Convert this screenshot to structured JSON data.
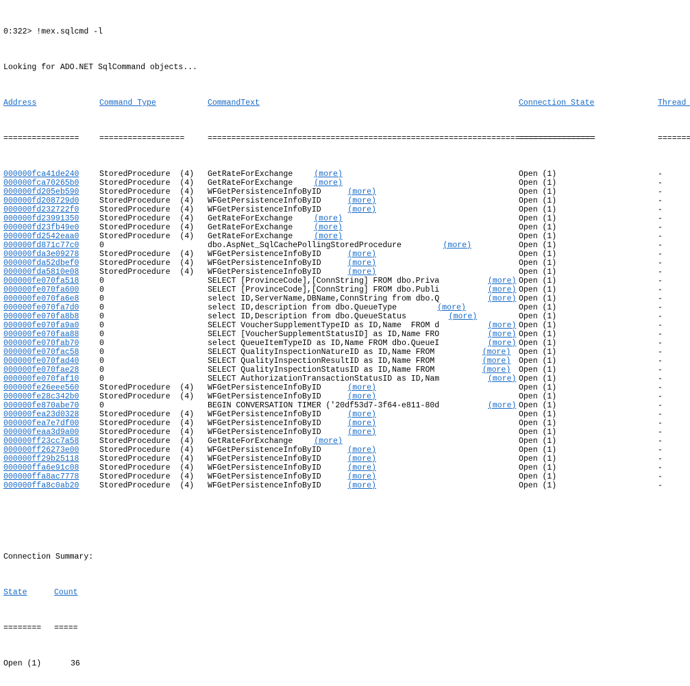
{
  "console": {
    "prompt_line": "0:322> !mex.sqlcmd -l",
    "status_line": "Looking for ADO.NET SqlCommand objects...",
    "more_label": "(more)",
    "dash": "-",
    "link_color": "#1569c7",
    "text_color": "#000000",
    "background_color": "#ffffff"
  },
  "table": {
    "headers": {
      "address": "Address",
      "command_type": "Command Type",
      "command_text": "CommandText",
      "connection_state": "Connection State",
      "thread_id": "Thread ID"
    },
    "separators": {
      "address": "================",
      "command_type": "==================",
      "command_text": "==================================================================================",
      "connection_state": "================",
      "thread_id": "========="
    },
    "rows": [
      {
        "address": "000000fca41de240",
        "type": "StoredProcedure  (4)",
        "text": "GetRateForExchange ",
        "more": true,
        "state": "Open (1)",
        "tid": "-"
      },
      {
        "address": "000000fca70265b0",
        "type": "StoredProcedure  (4)",
        "text": "GetRateForExchange ",
        "more": true,
        "state": "Open (1)",
        "tid": "-"
      },
      {
        "address": "000000fd205eb590",
        "type": "StoredProcedure  (4)",
        "text": "WFGetPersistenceInfoByID ",
        "more": true,
        "state": "Open (1)",
        "tid": "-"
      },
      {
        "address": "000000fd208729d0",
        "type": "StoredProcedure  (4)",
        "text": "WFGetPersistenceInfoByID ",
        "more": true,
        "state": "Open (1)",
        "tid": "-"
      },
      {
        "address": "000000fd232722f0",
        "type": "StoredProcedure  (4)",
        "text": "WFGetPersistenceInfoByID ",
        "more": true,
        "state": "Open (1)",
        "tid": "-"
      },
      {
        "address": "000000fd23991350",
        "type": "StoredProcedure  (4)",
        "text": "GetRateForExchange ",
        "more": true,
        "state": "Open (1)",
        "tid": "-"
      },
      {
        "address": "000000fd23fb49e0",
        "type": "StoredProcedure  (4)",
        "text": "GetRateForExchange ",
        "more": true,
        "state": "Open (1)",
        "tid": "-"
      },
      {
        "address": "000000fd2542eaa0",
        "type": "StoredProcedure  (4)",
        "text": "GetRateForExchange ",
        "more": true,
        "state": "Open (1)",
        "tid": "-"
      },
      {
        "address": "000000fd871c77c0",
        "type": "0",
        "text": "dbo.AspNet_SqlCachePollingStoredProcedure ",
        "more": true,
        "state": "Open (1)",
        "tid": "-"
      },
      {
        "address": "000000fda3e09278",
        "type": "StoredProcedure  (4)",
        "text": "WFGetPersistenceInfoByID ",
        "more": true,
        "state": "Open (1)",
        "tid": "-"
      },
      {
        "address": "000000fda52dbef0",
        "type": "StoredProcedure  (4)",
        "text": "WFGetPersistenceInfoByID ",
        "more": true,
        "state": "Open (1)",
        "tid": "-"
      },
      {
        "address": "000000fda5810e08",
        "type": "StoredProcedure  (4)",
        "text": "WFGetPersistenceInfoByID ",
        "more": true,
        "state": "Open (1)",
        "tid": "-"
      },
      {
        "address": "000000fe070fa518",
        "type": "0",
        "text": "SELECT [ProvinceCode],[ConnString] FROM dbo.Priva ",
        "more": true,
        "state": "Open (1)",
        "tid": "-"
      },
      {
        "address": "000000fe070fa600",
        "type": "0",
        "text": "SELECT [ProvinceCode],[ConnString] FROM dbo.Publi ",
        "more": true,
        "state": "Open (1)",
        "tid": "-"
      },
      {
        "address": "000000fe070fa6e8",
        "type": "0",
        "text": "select ID,ServerName,DBName,ConnString from dbo.Q ",
        "more": true,
        "state": "Open (1)",
        "tid": "-"
      },
      {
        "address": "000000fe070fa7d0",
        "type": "0",
        "text": "select ID,description from dbo.QueueType ",
        "more": true,
        "state": "Open (1)",
        "tid": "-"
      },
      {
        "address": "000000fe070fa8b8",
        "type": "0",
        "text": "select ID,Description from dbo.QueueStatus ",
        "more": true,
        "state": "Open (1)",
        "tid": "-"
      },
      {
        "address": "000000fe070fa9a0",
        "type": "0",
        "text": "SELECT VoucherSupplementTypeID as ID,Name  FROM d ",
        "more": true,
        "state": "Open (1)",
        "tid": "-"
      },
      {
        "address": "000000fe070faa88",
        "type": "0",
        "text": "SELECT [VoucherSupplementStatusID] as ID,Name FRO ",
        "more": true,
        "state": "Open (1)",
        "tid": "-"
      },
      {
        "address": "000000fe070fab70",
        "type": "0",
        "text": "select QueueItemTypeID as ID,Name FROM dbo.QueueI ",
        "more": true,
        "state": "Open (1)",
        "tid": "-"
      },
      {
        "address": "000000fe070fac58",
        "type": "0",
        "text": "SELECT QualityInspectionNatureID as ID,Name FROM ",
        "more": true,
        "state": "Open (1)",
        "tid": "-"
      },
      {
        "address": "000000fe070fad40",
        "type": "0",
        "text": "SELECT QualityInspectionResultID as ID,Name FROM ",
        "more": true,
        "state": "Open (1)",
        "tid": "-"
      },
      {
        "address": "000000fe070fae28",
        "type": "0",
        "text": "SELECT QualityInspectionStatusID as ID,Name FROM ",
        "more": true,
        "state": "Open (1)",
        "tid": "-"
      },
      {
        "address": "000000fe070faf10",
        "type": "0",
        "text": "SELECT AuthorizationTransactionStatusID as ID,Nam ",
        "more": true,
        "state": "Open (1)",
        "tid": "-"
      },
      {
        "address": "000000fe26eee560",
        "type": "StoredProcedure  (4)",
        "text": "WFGetPersistenceInfoByID ",
        "more": true,
        "state": "Open (1)",
        "tid": "-"
      },
      {
        "address": "000000fe28c342b0",
        "type": "StoredProcedure  (4)",
        "text": "WFGetPersistenceInfoByID ",
        "more": true,
        "state": "Open (1)",
        "tid": "-"
      },
      {
        "address": "000000fe870abe70",
        "type": "0",
        "text": "BEGIN CONVERSATION TIMER ('20df53d7-3f64-e811-80d ",
        "more": true,
        "state": "Open (1)",
        "tid": "-"
      },
      {
        "address": "000000fea23d0328",
        "type": "StoredProcedure  (4)",
        "text": "WFGetPersistenceInfoByID ",
        "more": true,
        "state": "Open (1)",
        "tid": "-"
      },
      {
        "address": "000000fea7e7df00",
        "type": "StoredProcedure  (4)",
        "text": "WFGetPersistenceInfoByID ",
        "more": true,
        "state": "Open (1)",
        "tid": "-"
      },
      {
        "address": "000000feaa3d9a00",
        "type": "StoredProcedure  (4)",
        "text": "WFGetPersistenceInfoByID ",
        "more": true,
        "state": "Open (1)",
        "tid": "-"
      },
      {
        "address": "000000ff23cc7a58",
        "type": "StoredProcedure  (4)",
        "text": "GetRateForExchange ",
        "more": true,
        "state": "Open (1)",
        "tid": "-"
      },
      {
        "address": "000000ff26273e00",
        "type": "StoredProcedure  (4)",
        "text": "WFGetPersistenceInfoByID ",
        "more": true,
        "state": "Open (1)",
        "tid": "-"
      },
      {
        "address": "000000ff29b25118",
        "type": "StoredProcedure  (4)",
        "text": "WFGetPersistenceInfoByID ",
        "more": true,
        "state": "Open (1)",
        "tid": "-"
      },
      {
        "address": "000000ffa6e91c08",
        "type": "StoredProcedure  (4)",
        "text": "WFGetPersistenceInfoByID ",
        "more": true,
        "state": "Open (1)",
        "tid": "-"
      },
      {
        "address": "000000ffa8ac7778",
        "type": "StoredProcedure  (4)",
        "text": "WFGetPersistenceInfoByID ",
        "more": true,
        "state": "Open (1)",
        "tid": "-"
      },
      {
        "address": "000000ffa8c0ab20",
        "type": "StoredProcedure  (4)",
        "text": "WFGetPersistenceInfoByID ",
        "more": true,
        "state": "Open (1)",
        "tid": "-"
      }
    ]
  },
  "summary": {
    "title": "Connection Summary:",
    "headers": {
      "state": "State",
      "count": "Count"
    },
    "separators": {
      "state": "========",
      "count": "====="
    },
    "rows": [
      {
        "state": "Open (1)",
        "count": "36"
      }
    ]
  }
}
